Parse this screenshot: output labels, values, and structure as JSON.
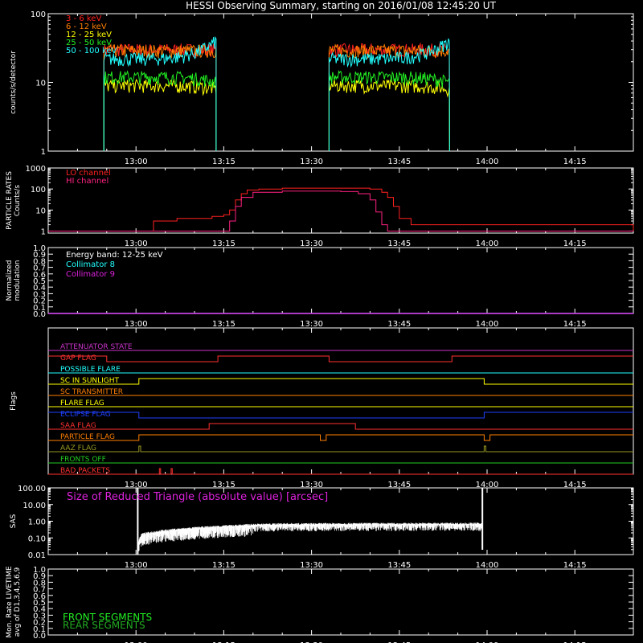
{
  "title": "HESSI Observing Summary, starting on 2016/01/08 12:45:20 UT",
  "time_ticks": [
    "13:00",
    "13:15",
    "13:30",
    "13:45",
    "14:00",
    "14:15"
  ],
  "time_tick_minutes": [
    15,
    30,
    45,
    60,
    75,
    90
  ],
  "time_range_minutes": [
    0,
    100
  ],
  "colors": {
    "background": "#000000",
    "axes": "#ffffff"
  },
  "chart_data": [
    {
      "id": "lightcurves",
      "type": "line",
      "ylabel": "counts/s/detector",
      "yscale": "log",
      "ylim": [
        1,
        100
      ],
      "ytick_labels": [
        "1",
        "10",
        "100"
      ],
      "ytick_values": [
        1,
        10,
        100
      ],
      "legend_placement": "top-left",
      "intervals": [
        [
          9.5,
          28.7
        ],
        [
          48.0,
          68.6
        ]
      ],
      "series": [
        {
          "name": "3 - 6 keV",
          "color": "#ff2020",
          "level": 30,
          "end_level": 30
        },
        {
          "name": "6 - 12 keV",
          "color": "#ff7f00",
          "level": 29,
          "end_level": 29
        },
        {
          "name": "12 - 25 keV",
          "color": "#ffff00",
          "level": 9,
          "end_level": 8
        },
        {
          "name": "25 - 50 keV",
          "color": "#22ee22",
          "level": 12,
          "end_level": 10
        },
        {
          "name": "50 - 100 keV",
          "color": "#22ffff",
          "level": 22,
          "end_level": 40
        }
      ]
    },
    {
      "id": "particle_rates",
      "type": "line",
      "ylabel": "PARTICLE RATES\nCounts/s",
      "yscale": "log",
      "ylim": [
        0.8,
        1000
      ],
      "ytick_labels": [
        "1",
        "10",
        "100",
        "1000"
      ],
      "ytick_values": [
        1,
        10,
        100,
        1000
      ],
      "legend_placement": "top-left",
      "series": [
        {
          "name": "LO channel",
          "color": "#ff2020",
          "x": [
            0,
            14,
            18,
            22,
            28,
            30,
            31,
            32,
            33,
            34,
            36,
            40,
            45,
            50,
            55,
            57,
            58,
            59,
            60,
            62,
            100
          ],
          "y": [
            1,
            1,
            3,
            4,
            5,
            6,
            10,
            30,
            60,
            90,
            100,
            110,
            110,
            110,
            100,
            70,
            40,
            15,
            4,
            2,
            1
          ]
        },
        {
          "name": "HI channel",
          "color": "#ff2080",
          "x": [
            0,
            30,
            31,
            32,
            33,
            35,
            40,
            45,
            50,
            53,
            55,
            56,
            57,
            58,
            100
          ],
          "y": [
            1,
            1,
            3,
            15,
            40,
            70,
            80,
            80,
            75,
            60,
            30,
            8,
            2,
            1,
            1
          ]
        }
      ]
    },
    {
      "id": "modulation",
      "type": "line",
      "ylabel": "Normalized\nmodulation",
      "ylim": [
        0,
        1
      ],
      "ytick_labels": [
        "0.0",
        "0.1",
        "0.2",
        "0.3",
        "0.4",
        "0.5",
        "0.6",
        "0.7",
        "0.8",
        "0.9",
        "1.0"
      ],
      "ytick_values": [
        0,
        0.1,
        0.2,
        0.3,
        0.4,
        0.5,
        0.6,
        0.7,
        0.8,
        0.9,
        1.0
      ],
      "legend_title": "Energy band: 12-25 keV",
      "legend_placement": "top-left",
      "series": [
        {
          "name": "Collimator 8",
          "color": "#22ffff",
          "x": [
            0,
            100
          ],
          "y": [
            0,
            0
          ]
        },
        {
          "name": "Collimator 9",
          "color": "#dd22dd",
          "x": [
            0,
            100
          ],
          "y": [
            0,
            0
          ]
        }
      ]
    },
    {
      "id": "flags",
      "type": "line",
      "ylabel": "Flags",
      "series": [
        {
          "name": "ATTENUATOR STATE",
          "color": "#cc33cc",
          "transitions": [],
          "initial": 0
        },
        {
          "name": "GAP FLAG",
          "color": "#ff3030",
          "transitions": [
            10,
            29,
            48,
            69
          ],
          "initial": 1
        },
        {
          "name": "POSSIBLE FLARE",
          "color": "#22ffff",
          "transitions": [],
          "initial": 0
        },
        {
          "name": "SC IN SUNLIGHT",
          "color": "#ffff00",
          "transitions": [
            15.5,
            74.5
          ],
          "initial": 0
        },
        {
          "name": "SC TRANSMITTER",
          "color": "#ff7f00",
          "transitions": [],
          "initial": 0
        },
        {
          "name": "FLARE FLAG",
          "color": "#ffff00",
          "transitions": [],
          "initial": 0
        },
        {
          "name": "ECLIPSE FLAG",
          "color": "#2040ff",
          "transitions": [
            15.5,
            74.5
          ],
          "initial": 1
        },
        {
          "name": "SAA FLAG",
          "color": "#ff3030",
          "transitions": [
            27.5,
            52.5
          ],
          "initial": 0
        },
        {
          "name": "PARTICLE FLAG",
          "color": "#ff7f00",
          "transitions": [
            15.5,
            46.5,
            47.5,
            74.5,
            75.5
          ],
          "initial": 0
        },
        {
          "name": "AAZ FLAG",
          "color": "#999922",
          "transitions": [
            15.5,
            15.8,
            74.5,
            74.8
          ],
          "initial": 0
        },
        {
          "name": "FRONTS OFF",
          "color": "#22cc22",
          "transitions": [],
          "initial": 0
        },
        {
          "name": "BAD PACKETS",
          "color": "#ff3030",
          "transitions": [
            19.0,
            19.2,
            21.0,
            21.2
          ],
          "initial": 0
        }
      ]
    },
    {
      "id": "sas",
      "type": "line",
      "ylabel": "SAS",
      "yscale": "log",
      "ylim": [
        0.01,
        100
      ],
      "ytick_labels": [
        "0.01",
        "0.10",
        "1.00",
        "10.00",
        "100.00"
      ],
      "ytick_values": [
        0.01,
        0.1,
        1,
        10,
        100
      ],
      "legend_placement": "top-left",
      "series": [
        {
          "name": "Size of Reduced Triangle (absolute value) [arcsec]",
          "color": "#ffffff",
          "x": [
            15.3,
            16,
            18,
            20,
            25,
            30,
            35,
            40,
            45,
            50,
            55,
            60,
            65,
            70,
            74.2
          ],
          "y": [
            0.03,
            0.15,
            0.2,
            0.25,
            0.35,
            0.45,
            0.55,
            0.6,
            0.6,
            0.62,
            0.62,
            0.62,
            0.63,
            0.63,
            0.63
          ]
        }
      ]
    },
    {
      "id": "livetime",
      "type": "line",
      "ylabel": "Mon. Rate LIVETIME\navg of D1,3,4,5,6,9",
      "ylim": [
        0,
        1
      ],
      "ytick_labels": [
        "0.0",
        "0.1",
        "0.2",
        "0.3",
        "0.4",
        "0.5",
        "0.6",
        "0.7",
        "0.8",
        "0.9",
        "1.0"
      ],
      "ytick_values": [
        0,
        0.1,
        0.2,
        0.3,
        0.4,
        0.5,
        0.6,
        0.7,
        0.8,
        0.9,
        1.0
      ],
      "legend_placement": "bottom-left",
      "series": [
        {
          "name": "FRONT SEGMENTS",
          "color": "#22ee22"
        },
        {
          "name": "REAR SEGMENTS",
          "color": "#22aa22"
        }
      ]
    }
  ]
}
